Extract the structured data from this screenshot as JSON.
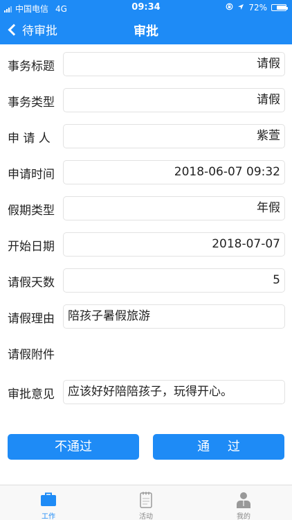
{
  "status_bar": {
    "carrier": "中国电信",
    "network": "4G",
    "time": "09:34",
    "battery": "72%",
    "battery_level": 0.72
  },
  "nav": {
    "back_label": "待审批",
    "title": "审批"
  },
  "form": {
    "fields": [
      {
        "label": "事务标题",
        "value": "请假"
      },
      {
        "label": "事务类型",
        "value": "请假"
      },
      {
        "label": "申 请 人",
        "value": "紫萱"
      },
      {
        "label": "申请时间",
        "value": "2018-06-07 09:32"
      },
      {
        "label": "假期类型",
        "value": "年假"
      },
      {
        "label": "开始日期",
        "value": "2018-07-07"
      },
      {
        "label": "请假天数",
        "value": "5"
      },
      {
        "label": "请假理由",
        "value": "陪孩子暑假旅游"
      },
      {
        "label": "请假附件"
      },
      {
        "label": "审批意见",
        "value": "应该好好陪陪孩子，玩得开心。"
      }
    ]
  },
  "actions": {
    "reject_label": "不通过",
    "approve_label": "通 过"
  },
  "tabbar": {
    "tabs": [
      {
        "label": "工作",
        "icon": "briefcase-icon",
        "active": true
      },
      {
        "label": "活动",
        "icon": "notebook-icon",
        "active": false
      },
      {
        "label": "我的",
        "icon": "user-icon",
        "active": false
      }
    ]
  },
  "colors": {
    "primary": "#1E8BF6",
    "tab_inactive": "#888888"
  }
}
